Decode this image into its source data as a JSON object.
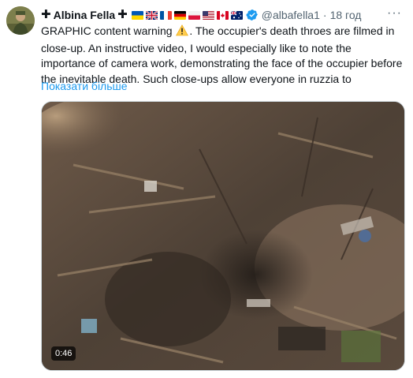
{
  "tweet": {
    "display_name": "Albina Fella",
    "cross_left": "✚",
    "cross_right": "✚",
    "flags": [
      "ua-flag-icon",
      "uk-flag-icon",
      "fr-flag-icon",
      "de-flag-icon",
      "pl-flag-icon",
      "us-flag-icon",
      "ca-flag-icon",
      "au-flag-icon"
    ],
    "handle": "@albafella1",
    "separator": "·",
    "timestamp": "18 год",
    "more_label": "···",
    "text_part1": "GRAPHIC content warning",
    "text_part2": ". The occupier's death throes are filmed in close-up. An instructive video, I would especially like to note the importance of camera work, demonstrating the face of the occupier before the inevitable death. Such close-ups allow everyone in ruzzia to",
    "show_more": "Показати більше",
    "video_duration": "0:46"
  },
  "colors": {
    "link": "#1d9bf0",
    "secondary_text": "#536471",
    "primary_text": "#0f1419"
  }
}
